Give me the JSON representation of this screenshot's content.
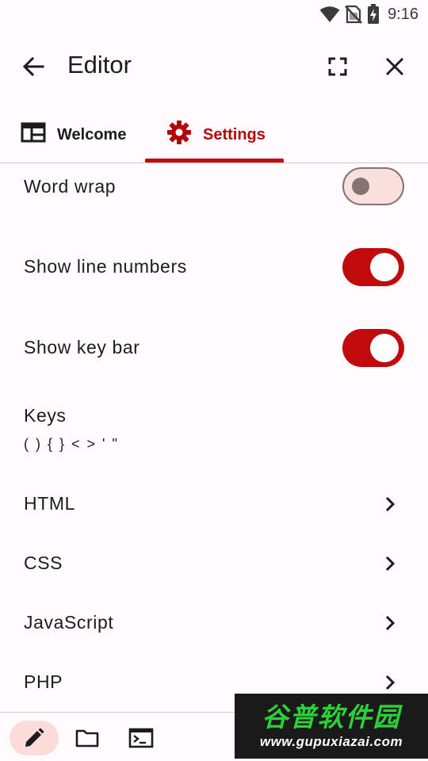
{
  "status_bar": {
    "time": "9:16",
    "icons": [
      "wifi-icon",
      "no-sim-icon",
      "battery-charging-icon"
    ]
  },
  "app_bar": {
    "title": "Editor",
    "icons": [
      "back-arrow-icon",
      "fullscreen-icon",
      "close-icon"
    ]
  },
  "tabs": [
    {
      "label": "Welcome",
      "icon": "browser-window-icon",
      "selected": false
    },
    {
      "label": "Settings",
      "icon": "gear-icon",
      "selected": true
    }
  ],
  "colors": {
    "accent": "#c00a0c",
    "accent_text": "#b3080b",
    "switch_off_track": "#f8e0dd",
    "switch_off_outline": "#857371",
    "background": "#fffbfe"
  },
  "settings": {
    "word_wrap": {
      "label": "Word wrap",
      "enabled": false
    },
    "show_line_numbers": {
      "label": "Show line numbers",
      "enabled": true
    },
    "show_key_bar": {
      "label": "Show key bar",
      "enabled": true
    },
    "keys": {
      "label": "Keys",
      "value": "( ) { } < > ' \""
    },
    "languages": [
      {
        "label": "HTML"
      },
      {
        "label": "CSS"
      },
      {
        "label": "JavaScript"
      },
      {
        "label": "PHP"
      }
    ]
  },
  "bottom_bar": {
    "buttons": [
      {
        "icon": "pencil-icon",
        "selected": true
      },
      {
        "icon": "folder-icon",
        "selected": false
      },
      {
        "icon": "terminal-icon",
        "selected": false
      }
    ]
  },
  "watermark": {
    "text_cn": "谷普软件园",
    "url": "www.gupuxiazai.com"
  }
}
